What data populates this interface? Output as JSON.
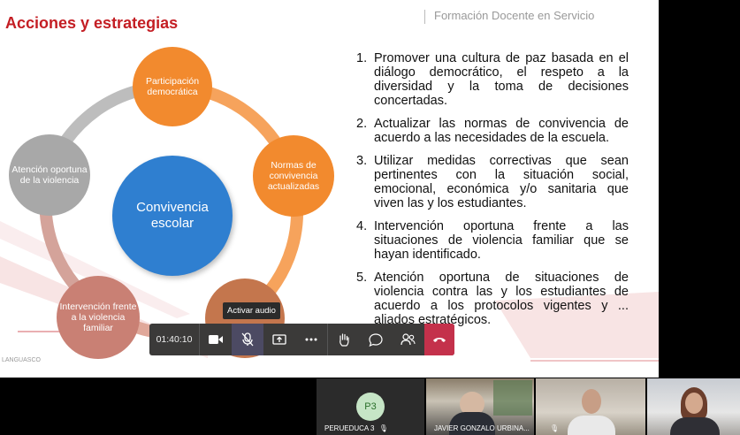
{
  "slide": {
    "title": "Acciones y estrategias",
    "header_right": "Formación Docente en Servicio",
    "watermark": "LANGUASCO",
    "center": "Convivencia escolar",
    "nodes": [
      {
        "id": "participacion",
        "label": "Participación democrática",
        "color": "#f28a2e"
      },
      {
        "id": "normas",
        "label": "Normas de convivencia actualizadas",
        "color": "#f28a2e"
      },
      {
        "id": "node-bottom-right",
        "label": "",
        "color": "#c4764d"
      },
      {
        "id": "intervencion",
        "label": "Intervención frente a la violencia familiar",
        "color": "#c98074"
      },
      {
        "id": "atencion",
        "label": "Atención oportuna de la violencia",
        "color": "#a8a8a8"
      }
    ],
    "items": [
      {
        "num": "1.",
        "text": "Promover una cultura de paz basada en el diálogo democrático, el respeto a la diversidad y la toma de decisiones concertadas."
      },
      {
        "num": "2.",
        "text": "Actualizar las normas de convivencia de acuerdo a las necesidades de la escuela."
      },
      {
        "num": "3.",
        "text": "Utilizar medidas correctivas que sean pertinentes con la situación social, emocional, económica y/o sanitaria que viven las y los estudiantes."
      },
      {
        "num": "4.",
        "text": "Intervención oportuna frente a las situaciones de violencia familiar que se hayan identificado."
      },
      {
        "num": "5.",
        "text": "Atención oportuna de situaciones de violencia contra las y los estudiantes de acuerdo a los protocolos vigentes y ... aliados estratégicos."
      }
    ]
  },
  "toolbar": {
    "time": "01:40:10",
    "tooltip": "Activar audio",
    "icons": [
      "camera-icon",
      "mic-off-icon",
      "share-screen-icon",
      "more-icon",
      "raise-hand-icon",
      "chat-icon",
      "participants-icon",
      "hang-up-icon"
    ],
    "hangup_color": "#c4314b"
  },
  "participants": [
    {
      "name": "PERUEDUCA 3",
      "initials": "P3"
    },
    {
      "name": "JAVIER GONZALO URBINA..."
    },
    {
      "name": ""
    },
    {
      "name": ""
    }
  ]
}
